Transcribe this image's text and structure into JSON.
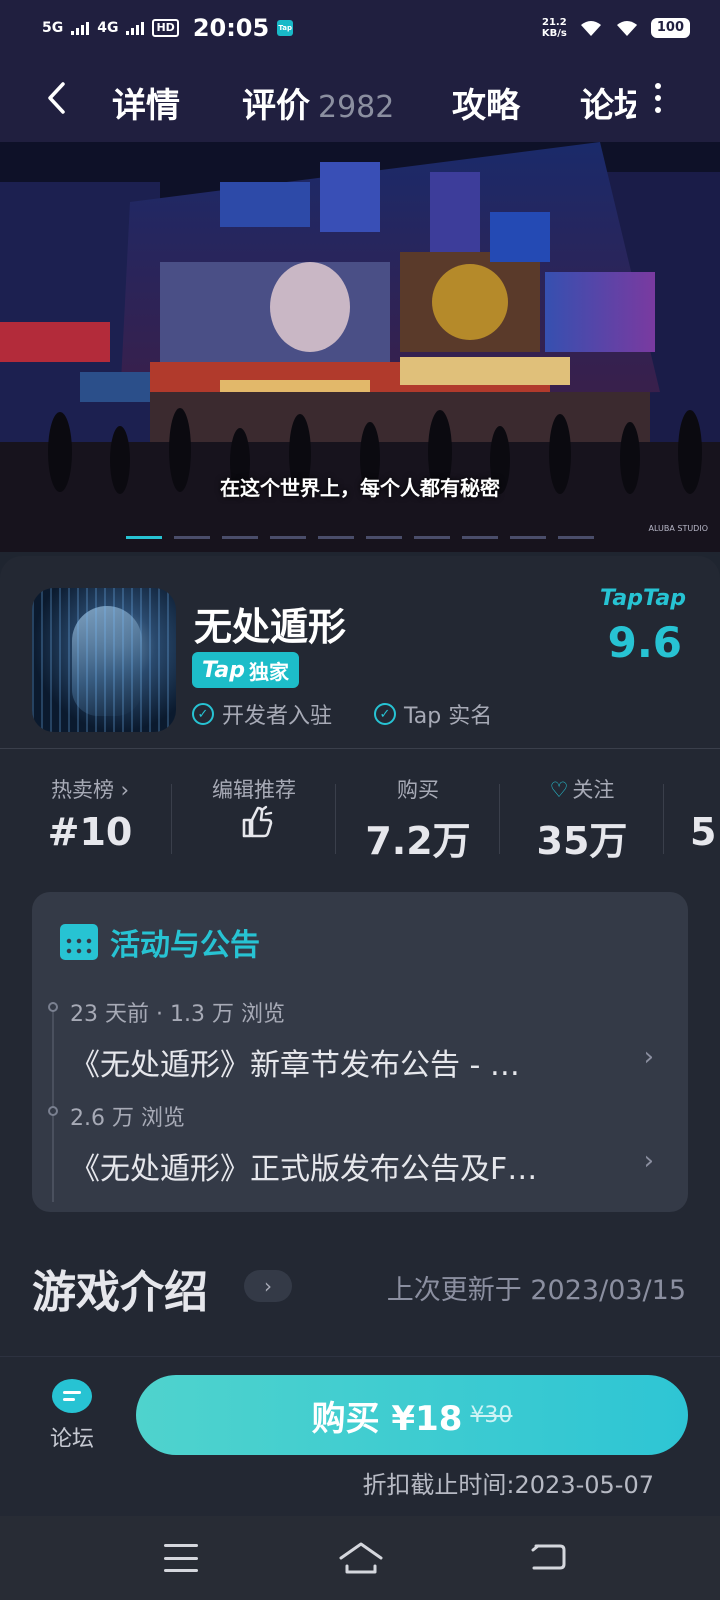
{
  "status": {
    "net1": "5G",
    "net2": "4G",
    "hd": "HD",
    "time": "20:05",
    "app_badge": "Tap",
    "speed_value": "21.2",
    "speed_unit": "KB/s",
    "battery": "100"
  },
  "nav": {
    "tabs": [
      "详情",
      "评价",
      "攻略",
      "论坛"
    ],
    "review_count": "2982"
  },
  "hero": {
    "caption": "在这个世界上，每个人都有秘密",
    "studio": "ALUBA STUDIO",
    "slide_count": 10,
    "active_slide": 0
  },
  "game": {
    "title": "无处遁形",
    "exclusive_brand": "Tap",
    "exclusive_label": "独家",
    "verify_1": "开发者入驻",
    "verify_2": "Tap 实名",
    "rating_brand": "TapTap",
    "rating": "9.6"
  },
  "stats": [
    {
      "label": "热卖榜 ›",
      "value": "#10"
    },
    {
      "label": "编辑推荐",
      "value": ""
    },
    {
      "label": "购买",
      "value": "7.2万"
    },
    {
      "label": "关注",
      "value": "35万"
    },
    {
      "label": "",
      "value": "5"
    }
  ],
  "notice": {
    "title": "活动与公告",
    "items": [
      {
        "meta": "23 天前 · 1.3 万 浏览",
        "title": "《无处遁形》新章节发布公告 - …"
      },
      {
        "meta": "2.6 万 浏览",
        "title": "《无处遁形》正式版发布公告及F…"
      }
    ]
  },
  "intro": {
    "title": "游戏介绍",
    "updated": "上次更新于 2023/03/15"
  },
  "bottom": {
    "forum_label": "论坛",
    "buy_label": "购买 ¥18",
    "original_price": "¥30",
    "deadline": "折扣截止时间:2023-05-07"
  },
  "colors": {
    "accent": "#27c3d3",
    "header_bg": "#201f3f",
    "card_bg": "#232833"
  },
  "icons": [
    "back-icon",
    "more-icon",
    "check-circle-icon",
    "thumb-up-icon",
    "heart-plus-icon",
    "calendar-icon",
    "chevron-right-icon",
    "forum-icon",
    "menu-icon",
    "home-icon",
    "back-system-icon"
  ]
}
